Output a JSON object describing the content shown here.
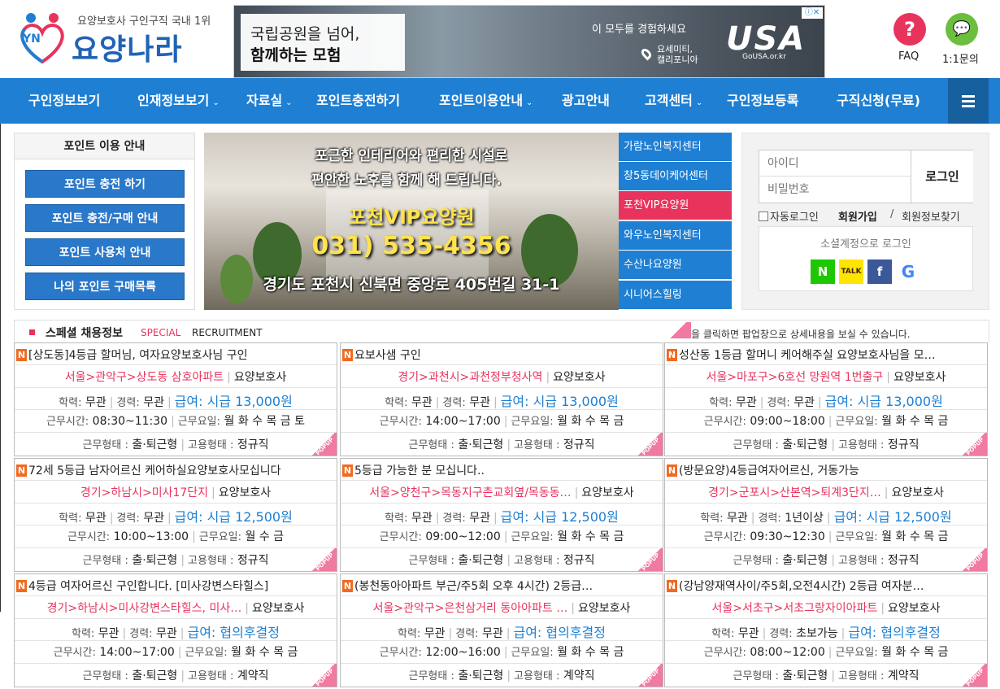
{
  "header": {
    "tagline": "요양보호사 구인구직 국내 1위",
    "logo_text": "요양나라",
    "logo_badge": "YN",
    "faq_label": "FAQ",
    "inquiry_label": "1:1문의"
  },
  "ad": {
    "line1": "국립공원을 넘어,",
    "line2": "함께하는 모험",
    "line3": "이 모두를 경험하세요",
    "place": "요세미티,\n캘리포니아",
    "brand": "USA",
    "brand_site": "GoUSA.or.kr"
  },
  "nav": [
    {
      "label": "구인정보보기",
      "chev": ""
    },
    {
      "label": "인재정보보기",
      "chev": "⌄"
    },
    {
      "label": "자료실",
      "chev": "⌄"
    },
    {
      "label": "포인트충전하기",
      "chev": ""
    },
    {
      "label": "포인트이용안내",
      "chev": "⌄"
    },
    {
      "label": "광고안내",
      "chev": ""
    },
    {
      "label": "고객센터",
      "chev": "⌄"
    },
    {
      "label": "구인정보등록",
      "chev": ""
    },
    {
      "label": "구직신청(무료)",
      "chev": ""
    }
  ],
  "point": {
    "title": "포인트 이용 안내",
    "buttons": [
      "포인트 충전 하기",
      "포인트 충전/구매 안내",
      "포인트 사용처 안내",
      "나의 포인트 구매목록"
    ]
  },
  "banner": {
    "line1": "포근한 인테리어와 편리한 시설로",
    "line2": "편안한 노후를 함께 해 드립니다.",
    "name": "포천VIP요양원",
    "tel": "031) 535-4356",
    "address": "경기도 포천시 신북면 중앙로 405번길 31-1"
  },
  "facilities": [
    "가람노인복지센터",
    "창5동데이케어센터",
    "포천VIP요양원",
    "와우노인복지센터",
    "수산나요양원",
    "시니어스힐링"
  ],
  "login": {
    "id_placeholder": "아이디",
    "pw_placeholder": "비밀번호",
    "button": "로그인",
    "auto_login": "자동로그인",
    "join": "회원가입",
    "slash": "/",
    "find": "회원정보찾기",
    "social_label": "소셜계정으로 로그인",
    "social": [
      "N",
      "TALK",
      "f",
      "G"
    ]
  },
  "special": {
    "title": "스페셜 채용정보",
    "en1": "SPECIAL",
    "en2": "RECRUITMENT",
    "note": "을 클릭하면 팝업창으로 상세내용을 보실 수 있습니다."
  },
  "labels": {
    "edu": "학력:",
    "career": "경력:",
    "hours": "근무시간:",
    "days": "근무요일:",
    "worktype": "근무형태 :",
    "emptype": "고용형태 :",
    "popup": "POPUP",
    "new_badge": "N"
  },
  "jobs": [
    {
      "title": "[상도동]4등급 할머님, 여자요양보호사님 구인",
      "loc": "서울>관악구>상도동 삼호아파트",
      "job": "요양보호사",
      "edu": "무관",
      "career": "무관",
      "pay": "급여: 시급 13,000원",
      "hours": "08:30~11:30",
      "days": "월 화 수 목 금 토",
      "worktype": "출·퇴근형",
      "emptype": "정규직"
    },
    {
      "title": "요보사샘 구인",
      "loc": "경기>과천시>과천정부청사역",
      "job": "요양보호사",
      "edu": "무관",
      "career": "무관",
      "pay": "급여: 시급 13,000원",
      "hours": "14:00~17:00",
      "days": "월 화 수 목 금",
      "worktype": "출·퇴근형",
      "emptype": "정규직"
    },
    {
      "title": "성산동 1등급 할머니 케어해주실 요양보호사님을 모…",
      "loc": "서울>마포구>6호선 망원역 1번출구",
      "job": "요양보호사",
      "edu": "무관",
      "career": "무관",
      "pay": "급여: 시급 13,000원",
      "hours": "09:00~18:00",
      "days": "월 화 수 목 금",
      "worktype": "출·퇴근형",
      "emptype": "정규직"
    },
    {
      "title": "72세 5등급 남자어르신 케어하실요양보호사모십니다",
      "loc": "경기>하남시>미사17단지",
      "job": "요양보호사",
      "edu": "무관",
      "career": "무관",
      "pay": "급여: 시급 12,500원",
      "hours": "10:00~13:00",
      "days": "월 수 금",
      "worktype": "출·퇴근형",
      "emptype": "정규직"
    },
    {
      "title": "5등급 가능한 분 모십니다..",
      "loc": "서울>양천구>목동지구촌교회옆/목동동…",
      "job": "요양보호사",
      "edu": "무관",
      "career": "무관",
      "pay": "급여: 시급 12,500원",
      "hours": "09:00~12:00",
      "days": "월 화 수 목 금",
      "worktype": "출·퇴근형",
      "emptype": "정규직"
    },
    {
      "title": "(방문요양)4등급여자어르신, 거동가능",
      "loc": "경기>군포시>산본역>퇴계3단지…",
      "job": "요양보호사",
      "edu": "무관",
      "career": "1년이상",
      "pay": "급여: 시급 12,500원",
      "hours": "09:30~12:30",
      "days": "월 화 수 목 금",
      "worktype": "출·퇴근형",
      "emptype": "정규직"
    },
    {
      "title": "4등급 여자어르신 구인합니다. [미사강변스타힐스]",
      "loc": "경기>하남시>미사강변스타힐스, 미사…",
      "job": "요양보호사",
      "edu": "무관",
      "career": "무관",
      "pay": "급여: 협의후결정",
      "hours": "14:00~17:00",
      "days": "월 화 수 목 금",
      "worktype": "출·퇴근형",
      "emptype": "계약직"
    },
    {
      "title": "(봉천동아아파트 부근/주5회 오후 4시간) 2등급…",
      "loc": "서울>관악구>은천삼거리 동아아파트 …",
      "job": "요양보호사",
      "edu": "무관",
      "career": "무관",
      "pay": "급여: 협의후결정",
      "hours": "12:00~16:00",
      "days": "월 화 수 목 금",
      "worktype": "출·퇴근형",
      "emptype": "계약직"
    },
    {
      "title": "(강남양재역사이/주5회,오전4시간) 2등급 여자분…",
      "loc": "서울>서초구>서초그랑자이아파트",
      "job": "요양보호사",
      "edu": "무관",
      "career": "초보가능",
      "pay": "급여: 협의후결정",
      "hours": "08:00~12:00",
      "days": "월 화 수 목 금",
      "worktype": "출·퇴근형",
      "emptype": "계약직"
    }
  ],
  "colors": {
    "primary": "#1e7fd3",
    "accent": "#e8335d",
    "new_badge": "#f06a20"
  }
}
